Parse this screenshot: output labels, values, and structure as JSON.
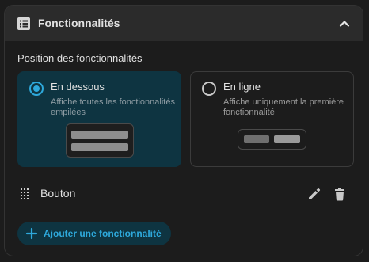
{
  "header": {
    "title": "Fonctionnalités",
    "icon": "list-box-icon",
    "collapse_icon": "chevron-up-icon"
  },
  "position": {
    "label": "Position des fonctionnalités",
    "options": [
      {
        "title": "En dessous",
        "description": "Affiche toutes les fonctionnalités empilées",
        "selected": true
      },
      {
        "title": "En ligne",
        "description": "Affiche uniquement la première fonctionnalité",
        "selected": false
      }
    ]
  },
  "features": [
    {
      "label": "Bouton"
    }
  ],
  "actions": {
    "add_label": "Ajouter une fonctionnalité"
  },
  "colors": {
    "accent": "#2ea9dc",
    "selected_bg": "#0e3441",
    "header_bg": "#2b2b2b",
    "background": "#1c1c1c"
  }
}
